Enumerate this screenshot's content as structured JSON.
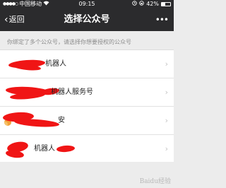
{
  "status_bar": {
    "carrier": "中国移动",
    "time": "09:15",
    "battery_text": "42%",
    "battery_level": 0.42
  },
  "nav": {
    "back_label": "返回",
    "title": "选择公众号",
    "more_label": "•••"
  },
  "hint": "你绑定了多个公众号，请选择你想要授权的公众号",
  "accounts": [
    {
      "label": "机器人"
    },
    {
      "label": "机器人服务号"
    },
    {
      "label": "安"
    },
    {
      "label": "机器人"
    }
  ],
  "watermark": "Baidu经验",
  "colors": {
    "header": "#2b2b2d",
    "background": "#ececec",
    "redaction": "#f01515",
    "chevron": "#c3c3c3"
  },
  "icons": {
    "back": "chevron-left-icon",
    "more": "more-dots-icon",
    "row": "chevron-right-icon",
    "wifi": "wifi-icon",
    "battery": "battery-icon"
  }
}
